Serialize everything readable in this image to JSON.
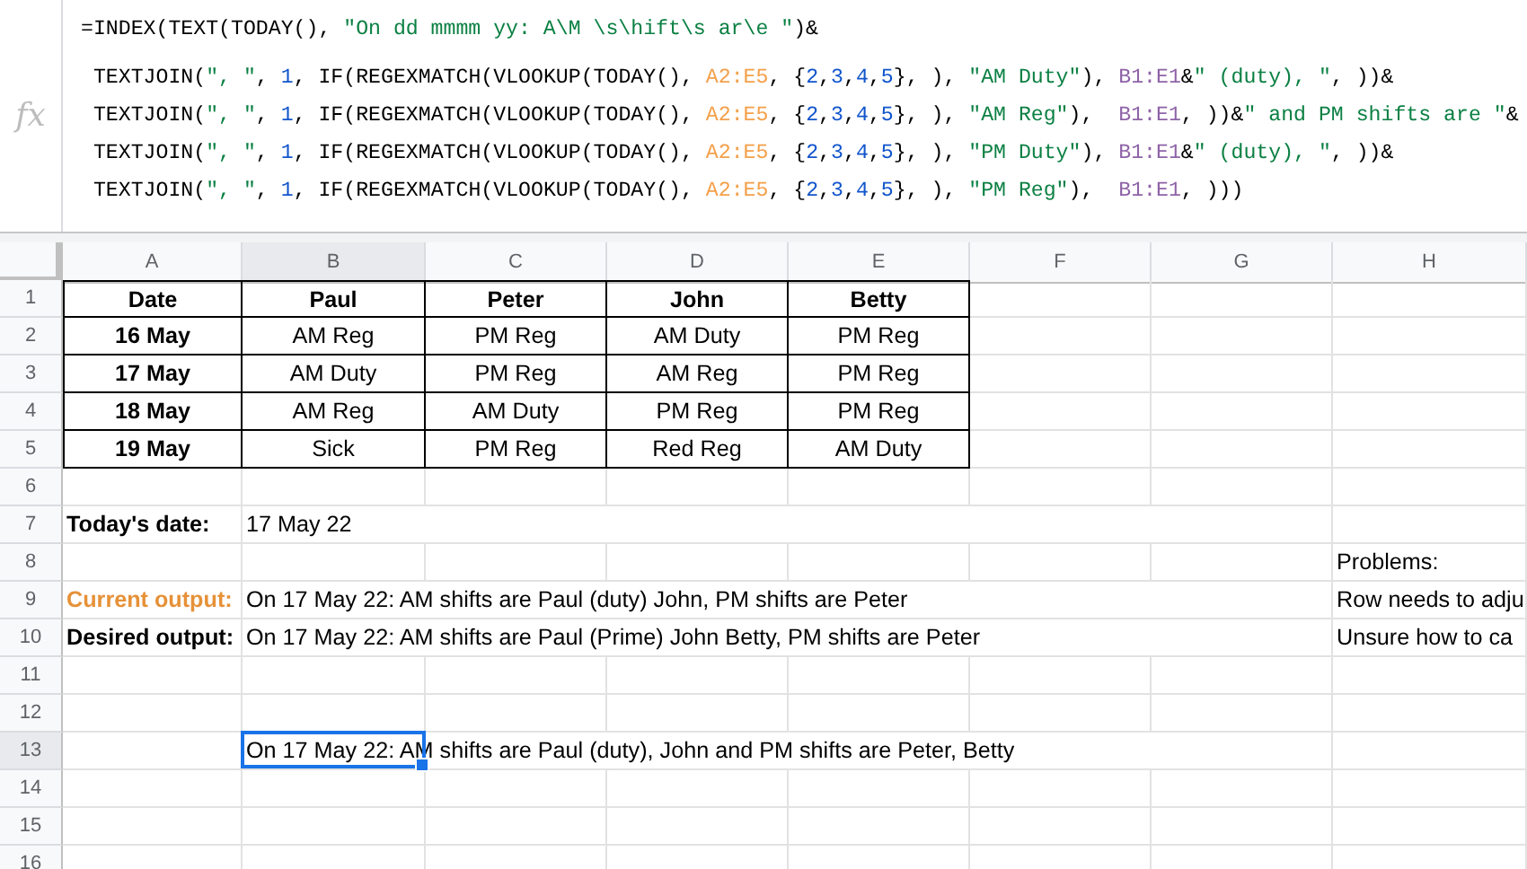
{
  "formula_bar": {
    "fx_label": "fx",
    "lines": [
      [
        {
          "text": "=INDEX(TEXT(TODAY(), ",
          "kind": "plain"
        },
        {
          "text": "\"On dd mmmm yy: A\\M \\s\\hift\\s ar\\e \"",
          "kind": "string"
        },
        {
          "text": ")&",
          "kind": "plain"
        }
      ],
      [
        {
          "text": " TEXTJOIN(",
          "kind": "plain"
        },
        {
          "text": "\", \"",
          "kind": "string"
        },
        {
          "text": ", ",
          "kind": "plain"
        },
        {
          "text": "1",
          "kind": "number"
        },
        {
          "text": ", IF(REGEXMATCH(VLOOKUP(TODAY(), ",
          "kind": "plain"
        },
        {
          "text": "A2:E5",
          "kind": "range"
        },
        {
          "text": ", {",
          "kind": "plain"
        },
        {
          "text": "2",
          "kind": "number"
        },
        {
          "text": ",",
          "kind": "plain"
        },
        {
          "text": "3",
          "kind": "number"
        },
        {
          "text": ",",
          "kind": "plain"
        },
        {
          "text": "4",
          "kind": "number"
        },
        {
          "text": ",",
          "kind": "plain"
        },
        {
          "text": "5",
          "kind": "number"
        },
        {
          "text": "}, ), ",
          "kind": "plain"
        },
        {
          "text": "\"AM Duty\"",
          "kind": "string"
        },
        {
          "text": "), ",
          "kind": "plain"
        },
        {
          "text": "B1:E1",
          "kind": "ref"
        },
        {
          "text": "&",
          "kind": "plain"
        },
        {
          "text": "\" (duty), \"",
          "kind": "string"
        },
        {
          "text": ", ))&",
          "kind": "plain"
        }
      ],
      [
        {
          "text": " TEXTJOIN(",
          "kind": "plain"
        },
        {
          "text": "\", \"",
          "kind": "string"
        },
        {
          "text": ", ",
          "kind": "plain"
        },
        {
          "text": "1",
          "kind": "number"
        },
        {
          "text": ", IF(REGEXMATCH(VLOOKUP(TODAY(), ",
          "kind": "plain"
        },
        {
          "text": "A2:E5",
          "kind": "range"
        },
        {
          "text": ", {",
          "kind": "plain"
        },
        {
          "text": "2",
          "kind": "number"
        },
        {
          "text": ",",
          "kind": "plain"
        },
        {
          "text": "3",
          "kind": "number"
        },
        {
          "text": ",",
          "kind": "plain"
        },
        {
          "text": "4",
          "kind": "number"
        },
        {
          "text": ",",
          "kind": "plain"
        },
        {
          "text": "5",
          "kind": "number"
        },
        {
          "text": "}, ), ",
          "kind": "plain"
        },
        {
          "text": "\"AM Reg\"",
          "kind": "string"
        },
        {
          "text": "),  ",
          "kind": "plain"
        },
        {
          "text": "B1:E1",
          "kind": "ref"
        },
        {
          "text": ", ))&",
          "kind": "plain"
        },
        {
          "text": "\" and PM shifts are \"",
          "kind": "string"
        },
        {
          "text": "&",
          "kind": "plain"
        }
      ],
      [
        {
          "text": " TEXTJOIN(",
          "kind": "plain"
        },
        {
          "text": "\", \"",
          "kind": "string"
        },
        {
          "text": ", ",
          "kind": "plain"
        },
        {
          "text": "1",
          "kind": "number"
        },
        {
          "text": ", IF(REGEXMATCH(VLOOKUP(TODAY(), ",
          "kind": "plain"
        },
        {
          "text": "A2:E5",
          "kind": "range"
        },
        {
          "text": ", {",
          "kind": "plain"
        },
        {
          "text": "2",
          "kind": "number"
        },
        {
          "text": ",",
          "kind": "plain"
        },
        {
          "text": "3",
          "kind": "number"
        },
        {
          "text": ",",
          "kind": "plain"
        },
        {
          "text": "4",
          "kind": "number"
        },
        {
          "text": ",",
          "kind": "plain"
        },
        {
          "text": "5",
          "kind": "number"
        },
        {
          "text": "}, ), ",
          "kind": "plain"
        },
        {
          "text": "\"PM Duty\"",
          "kind": "string"
        },
        {
          "text": "), ",
          "kind": "plain"
        },
        {
          "text": "B1:E1",
          "kind": "ref"
        },
        {
          "text": "&",
          "kind": "plain"
        },
        {
          "text": "\" (duty), \"",
          "kind": "string"
        },
        {
          "text": ", ))&",
          "kind": "plain"
        }
      ],
      [
        {
          "text": " TEXTJOIN(",
          "kind": "plain"
        },
        {
          "text": "\", \"",
          "kind": "string"
        },
        {
          "text": ", ",
          "kind": "plain"
        },
        {
          "text": "1",
          "kind": "number"
        },
        {
          "text": ", IF(REGEXMATCH(VLOOKUP(TODAY(), ",
          "kind": "plain"
        },
        {
          "text": "A2:E5",
          "kind": "range"
        },
        {
          "text": ", {",
          "kind": "plain"
        },
        {
          "text": "2",
          "kind": "number"
        },
        {
          "text": ",",
          "kind": "plain"
        },
        {
          "text": "3",
          "kind": "number"
        },
        {
          "text": ",",
          "kind": "plain"
        },
        {
          "text": "4",
          "kind": "number"
        },
        {
          "text": ",",
          "kind": "plain"
        },
        {
          "text": "5",
          "kind": "number"
        },
        {
          "text": "}, ), ",
          "kind": "plain"
        },
        {
          "text": "\"PM Reg\"",
          "kind": "string"
        },
        {
          "text": "),  ",
          "kind": "plain"
        },
        {
          "text": "B1:E1",
          "kind": "ref"
        },
        {
          "text": ", )))",
          "kind": "plain"
        }
      ]
    ]
  },
  "columns": [
    {
      "label": "A",
      "selected": false
    },
    {
      "label": "B",
      "selected": true
    },
    {
      "label": "C",
      "selected": false
    },
    {
      "label": "D",
      "selected": false
    },
    {
      "label": "E",
      "selected": false
    },
    {
      "label": "F",
      "selected": false
    },
    {
      "label": "G",
      "selected": false
    },
    {
      "label": "H",
      "selected": false
    }
  ],
  "rows": [
    {
      "number": "1",
      "selected": false,
      "cells": [
        {
          "text": "Date",
          "kind": "head",
          "selected": false
        },
        {
          "text": "Paul",
          "kind": "head",
          "selected": false
        },
        {
          "text": "Peter",
          "kind": "head",
          "selected": false
        },
        {
          "text": "John",
          "kind": "head",
          "selected": false
        },
        {
          "text": "Betty",
          "kind": "head",
          "selected": false
        }
      ]
    },
    {
      "number": "2",
      "selected": false,
      "cells": [
        {
          "text": "16 May",
          "kind": "head",
          "selected": false
        },
        {
          "text": "AM Reg",
          "kind": "entry",
          "selected": false
        },
        {
          "text": "PM Reg",
          "kind": "entry",
          "selected": false
        },
        {
          "text": "AM Duty",
          "kind": "entry",
          "selected": false
        },
        {
          "text": "PM Reg",
          "kind": "entry",
          "selected": false
        }
      ]
    },
    {
      "number": "3",
      "selected": false,
      "cells": [
        {
          "text": "17 May",
          "kind": "head",
          "selected": false
        },
        {
          "text": "AM Duty",
          "kind": "entry",
          "selected": false
        },
        {
          "text": "PM Reg",
          "kind": "entry",
          "selected": false
        },
        {
          "text": "AM Reg",
          "kind": "entry",
          "selected": false
        },
        {
          "text": "PM Reg",
          "kind": "entry",
          "selected": false
        }
      ]
    },
    {
      "number": "4",
      "selected": false,
      "cells": [
        {
          "text": "18 May",
          "kind": "head",
          "selected": false
        },
        {
          "text": "AM Reg",
          "kind": "entry",
          "selected": false
        },
        {
          "text": "AM Duty",
          "kind": "entry",
          "selected": false
        },
        {
          "text": "PM Reg",
          "kind": "entry",
          "selected": false
        },
        {
          "text": "PM Reg",
          "kind": "entry",
          "selected": false
        }
      ]
    },
    {
      "number": "5",
      "selected": false,
      "cells": [
        {
          "text": "19 May",
          "kind": "head",
          "selected": false
        },
        {
          "text": "Sick",
          "kind": "entry",
          "selected": false
        },
        {
          "text": "PM Reg",
          "kind": "entry",
          "selected": false
        },
        {
          "text": "Red Reg",
          "kind": "entry",
          "selected": false
        },
        {
          "text": "AM Duty",
          "kind": "entry",
          "selected": false
        }
      ]
    },
    {
      "number": "6",
      "selected": false,
      "cells": []
    },
    {
      "number": "7",
      "selected": false,
      "cells": [
        {
          "text": "Today's date:",
          "kind": "label",
          "selected": false
        },
        {
          "text": "17 May 22",
          "kind": "text",
          "selected": false
        }
      ]
    },
    {
      "number": "8",
      "selected": false,
      "cells": [
        null,
        null,
        null,
        null,
        null,
        null,
        null,
        {
          "text": "Problems:",
          "kind": "text",
          "selected": false
        }
      ]
    },
    {
      "number": "9",
      "selected": false,
      "cells": [
        {
          "text": "Current output:",
          "kind": "accent",
          "selected": false
        },
        {
          "text": "On 17 May 22: AM shifts are Paul (duty) John, PM shifts are Peter",
          "kind": "text",
          "selected": false
        },
        null,
        null,
        null,
        null,
        null,
        {
          "text": "Row needs to adju",
          "kind": "text",
          "selected": false
        }
      ]
    },
    {
      "number": "10",
      "selected": false,
      "cells": [
        {
          "text": "Desired output:",
          "kind": "label",
          "selected": false
        },
        {
          "text": "On 17 May 22: AM shifts are Paul (Prime) John Betty, PM shifts are Peter",
          "kind": "text",
          "selected": false
        },
        null,
        null,
        null,
        null,
        null,
        {
          "text": "Unsure how to ca",
          "kind": "text",
          "selected": false
        }
      ]
    },
    {
      "number": "11",
      "selected": false,
      "cells": []
    },
    {
      "number": "12",
      "selected": false,
      "cells": []
    },
    {
      "number": "13",
      "selected": true,
      "cells": [
        null,
        {
          "text": "On 17 May 22: AM shifts are Paul (duty), John and PM shifts are Peter, Betty",
          "kind": "text",
          "selected": true
        }
      ]
    },
    {
      "number": "14",
      "selected": false,
      "cells": []
    },
    {
      "number": "15",
      "selected": false,
      "cells": []
    },
    {
      "number": "16",
      "selected": false,
      "cells": []
    }
  ]
}
